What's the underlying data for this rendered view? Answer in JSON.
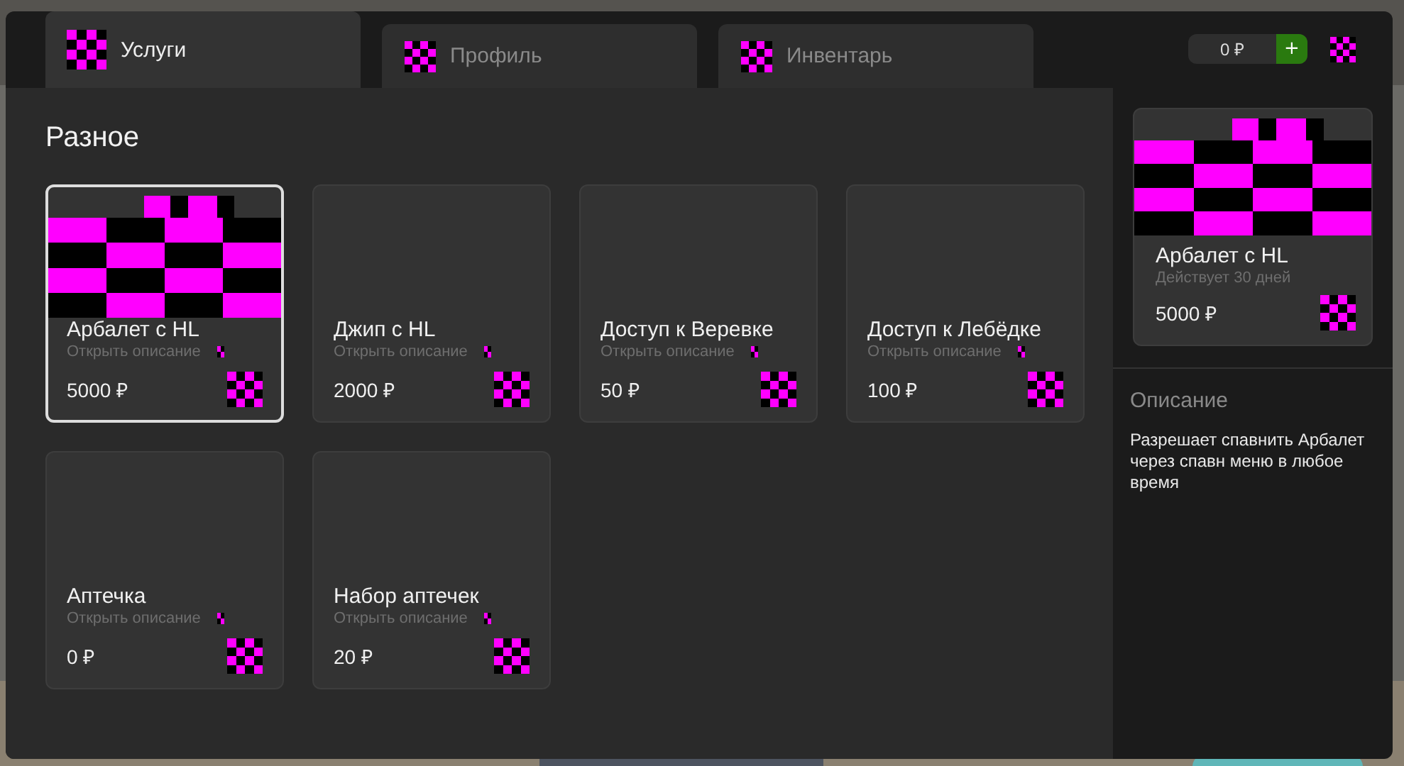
{
  "tabs": [
    {
      "label": "Услуги",
      "selected": true
    },
    {
      "label": "Профиль",
      "selected": false
    },
    {
      "label": "Инвентарь",
      "selected": false
    }
  ],
  "balance": {
    "amount": "0 ₽",
    "add_label": "+"
  },
  "section_title": "Разное",
  "items": [
    {
      "name": "Арбалет с HL",
      "link": "Открыть описание",
      "price": "5000 ₽",
      "image": true,
      "selected": true
    },
    {
      "name": "Джип с HL",
      "link": "Открыть описание",
      "price": "2000 ₽",
      "image": false,
      "selected": false
    },
    {
      "name": "Доступ к Веревке",
      "link": "Открыть описание",
      "price": "50 ₽",
      "image": false,
      "selected": false
    },
    {
      "name": "Доступ к Лебёдке",
      "link": "Открыть описание",
      "price": "100 ₽",
      "image": false,
      "selected": false
    },
    {
      "name": "Аптечка",
      "link": "Открыть описание",
      "price": "0 ₽",
      "image": false,
      "selected": false
    },
    {
      "name": "Набор аптечек",
      "link": "Открыть описание",
      "price": "20 ₽",
      "image": false,
      "selected": false
    }
  ],
  "details": {
    "name": "Арбалет с HL",
    "duration": "Действует 30 дней",
    "price": "5000 ₽",
    "image": true,
    "description_title": "Описание",
    "description": "Разрешает спавнить Арбалет через спавн меню в любое время"
  }
}
